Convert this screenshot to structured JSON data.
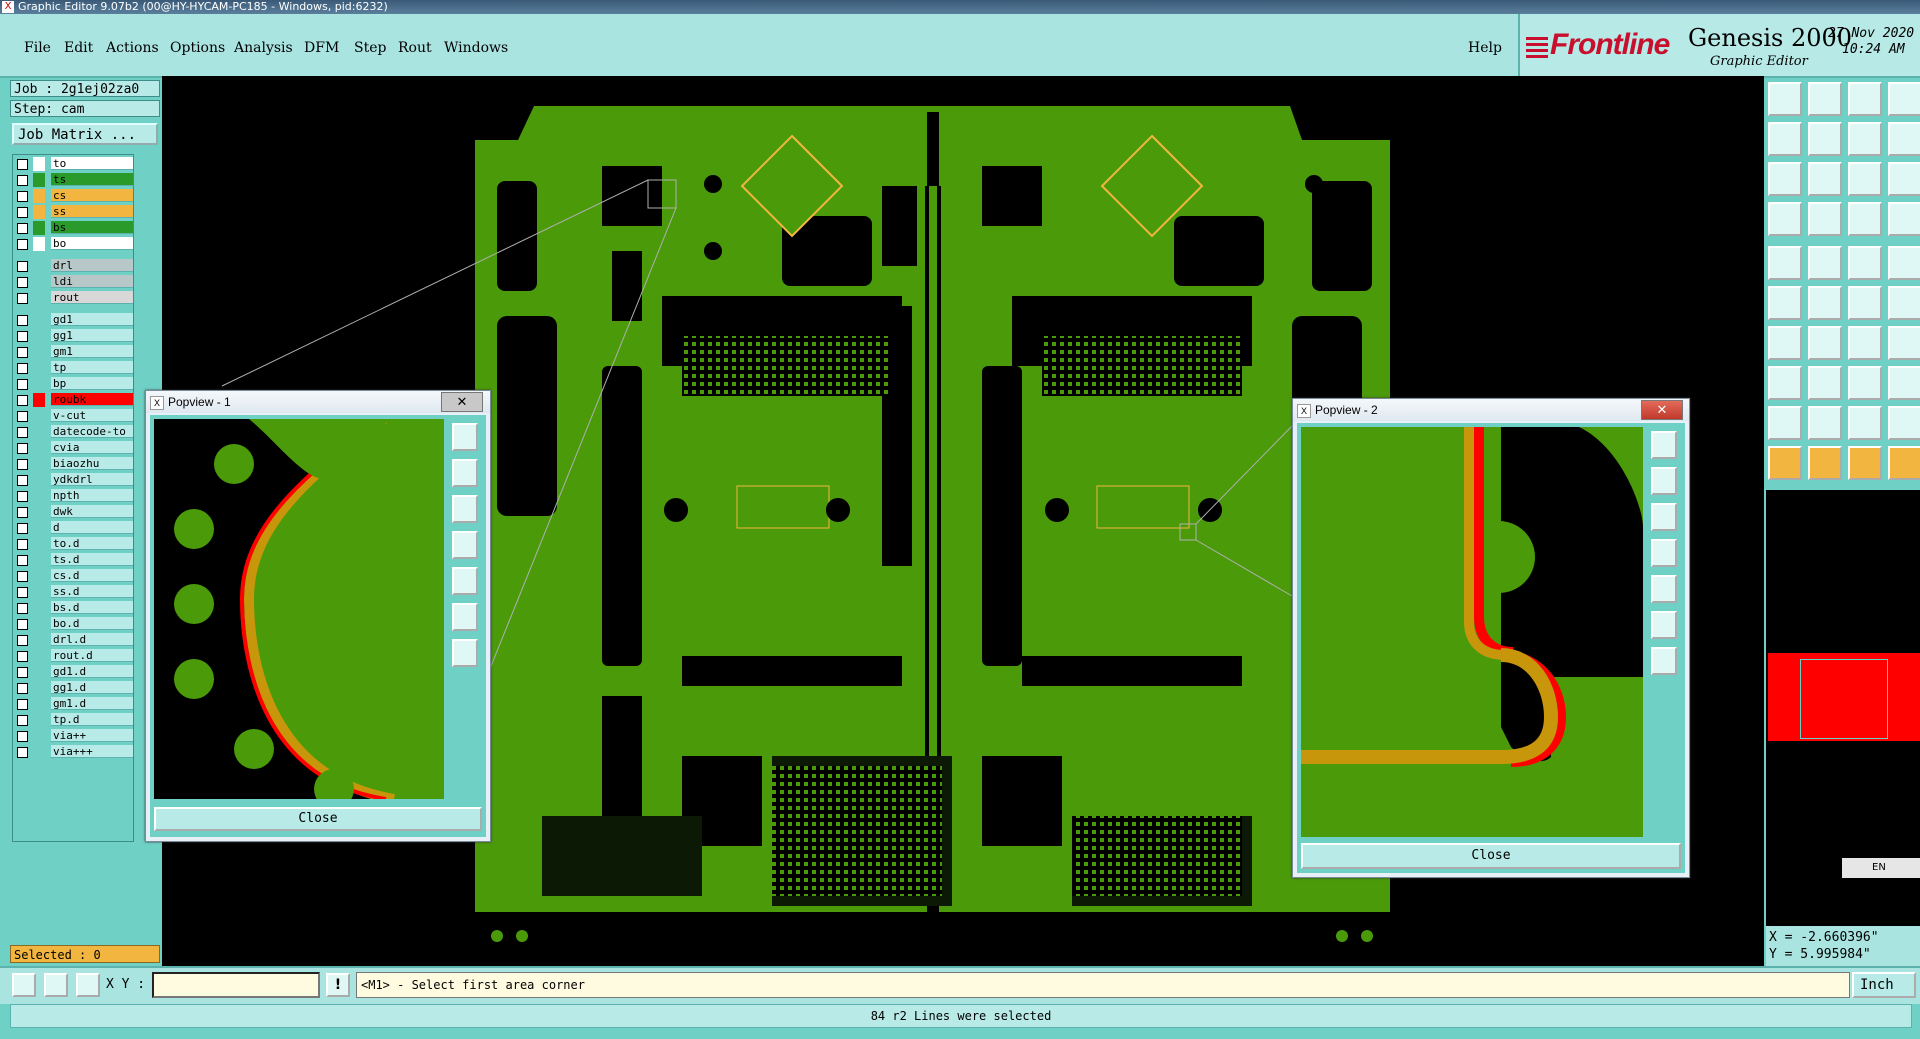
{
  "window": {
    "title": "Graphic Editor 9.07b2 (00@HY-HYCAM-PC185 - Windows, pid:6232)"
  },
  "menu": {
    "items": [
      "File",
      "Edit",
      "Actions",
      "Options",
      "Analysis",
      "DFM",
      "Step",
      "Rout",
      "Windows"
    ],
    "help": "Help"
  },
  "brand": {
    "logo": "Frontline",
    "product": "Genesis 2000",
    "subtitle": "Graphic Editor",
    "date": "27 Nov 2020",
    "time": "10:24 AM"
  },
  "job": {
    "job_label": "Job : 2g1ej02za0",
    "step_label": "Step: cam",
    "matrix_button": "Job Matrix ..."
  },
  "layers": [
    {
      "name": "to",
      "color": "#ffffff"
    },
    {
      "name": "ts",
      "color": "#2a9a2a"
    },
    {
      "name": "cs",
      "color": "#f2b640"
    },
    {
      "name": "ss",
      "color": "#f2b640"
    },
    {
      "name": "bs",
      "color": "#2a9a2a"
    },
    {
      "name": "bo",
      "color": "#ffffff"
    },
    {
      "name": "drl",
      "color": "#b8c8c8"
    },
    {
      "name": "ldi",
      "color": "#b8c8c8"
    },
    {
      "name": "rout",
      "color": "#d8d8d8"
    },
    {
      "name": "gd1",
      "color": "#b8ebe8"
    },
    {
      "name": "gg1",
      "color": "#b8ebe8"
    },
    {
      "name": "gm1",
      "color": "#b8ebe8"
    },
    {
      "name": "tp",
      "color": "#b8ebe8"
    },
    {
      "name": "bp",
      "color": "#b8ebe8"
    },
    {
      "name": "roubk",
      "color": "#ff0000"
    },
    {
      "name": "v-cut",
      "color": "#b8ebe8"
    },
    {
      "name": "datecode-to",
      "color": "#b8ebe8"
    },
    {
      "name": "cvia",
      "color": "#b8ebe8"
    },
    {
      "name": "biaozhu",
      "color": "#b8ebe8"
    },
    {
      "name": "ydkdrl",
      "color": "#b8ebe8"
    },
    {
      "name": "npth",
      "color": "#b8ebe8"
    },
    {
      "name": "dwk",
      "color": "#b8ebe8"
    },
    {
      "name": "d",
      "color": "#b8ebe8"
    },
    {
      "name": "to.d",
      "color": "#b8ebe8"
    },
    {
      "name": "ts.d",
      "color": "#b8ebe8"
    },
    {
      "name": "cs.d",
      "color": "#b8ebe8"
    },
    {
      "name": "ss.d",
      "color": "#b8ebe8"
    },
    {
      "name": "bs.d",
      "color": "#b8ebe8"
    },
    {
      "name": "bo.d",
      "color": "#b8ebe8"
    },
    {
      "name": "drl.d",
      "color": "#b8ebe8"
    },
    {
      "name": "rout.d",
      "color": "#b8ebe8"
    },
    {
      "name": "gd1.d",
      "color": "#b8ebe8"
    },
    {
      "name": "gg1.d",
      "color": "#b8ebe8"
    },
    {
      "name": "gm1.d",
      "color": "#b8ebe8"
    },
    {
      "name": "tp.d",
      "color": "#b8ebe8"
    },
    {
      "name": "via++",
      "color": "#b8ebe8"
    },
    {
      "name": "via+++",
      "color": "#b8ebe8"
    }
  ],
  "selected": "Selected : 0",
  "popview1": {
    "title": "Popview - 1",
    "close_button": "Close",
    "close_x": "✕"
  },
  "popview2": {
    "title": "Popview - 2",
    "close_button": "Close",
    "close_x": "✕"
  },
  "ime": {
    "label": "EN"
  },
  "coords": {
    "x": "X = -2.660396\"",
    "y": "Y = 5.995984\""
  },
  "command": {
    "xy_label": "X Y :",
    "xy_value": "",
    "prompt": "<M1> - Select first area corner",
    "unit": "Inch"
  },
  "status": "84 r2 Lines were selected",
  "colors": {
    "board": "#4a9a0a",
    "canvas": "#000000",
    "panel": "#6fd0c6",
    "highlight": "#f2b640",
    "outline_red": "#ff0000"
  }
}
